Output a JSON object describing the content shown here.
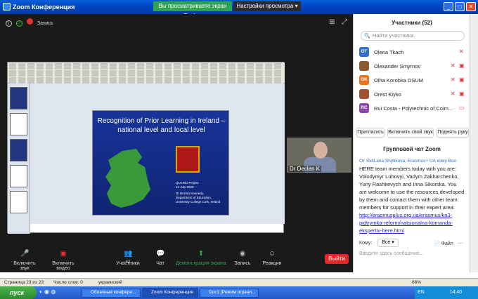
{
  "window": {
    "title": "Zoom Конференция"
  },
  "share_banner": {
    "text": "Вы просматриваете экран Declan",
    "view_options": "Настройки просмотра ▾"
  },
  "meeting": {
    "record_label": "Запись"
  },
  "slide": {
    "title": "Recognition of Prior Learning in Ireland – national level and local level",
    "project": "QUARiU Project\n14 July 2020",
    "author": "Dr Declan Kennedy,\nDepartment of Education,\nUniversity College Cork, Ireland"
  },
  "video": {
    "name": "Dr Declan K"
  },
  "toolbar": {
    "unmute": "Включить звук",
    "start_video": "Включить видео",
    "participants": "Участники",
    "participants_count": "62",
    "chat": "Чат",
    "share": "Демонстрация экрана",
    "record": "Запись",
    "reactions": "Реакции",
    "end": "Выйти"
  },
  "participants_panel": {
    "title": "Участники (52)",
    "search_placeholder": "Найти участника",
    "items": [
      {
        "initials": "OT",
        "name": "Olena Tkach",
        "color": "#2d6fcd"
      },
      {
        "initials": "",
        "name": "Olexander Smyrnov",
        "color": "#8b5a2b"
      },
      {
        "initials": "OK",
        "name": "Olha Korobka DSUM",
        "color": "#e8731a"
      },
      {
        "initials": "",
        "name": "Orest Kiyko",
        "color": "#a0522d"
      },
      {
        "initials": "RC",
        "name": "Rui Costa - Polytechnic of Coim...",
        "color": "#8e44ad"
      }
    ],
    "invite": "Пригласить",
    "unmute_me": "Включить свой звук",
    "raise_hand": "Поднять руку"
  },
  "chat_panel": {
    "title": "Групповой чат Zoom",
    "from": "От SvitLana Shytikova, Erasmus+ UA кому Все:",
    "message": "HERE team members today with you are: Volodymyr Luhovyi, Vadym Zakharchenko, Yuriy Rashkevych and Inna Sikorska. You are welcome to use the resources developed by them and contact them with other team members for support in their expert area:",
    "link": "http://erasmusplus.org.ua/erasmus/ka3-pidtrymka-reform/natsionalna-komanda-ekspertiv-here.html",
    "to_label": "Кому:",
    "to_value": "Все ▾",
    "file_label": "Файл",
    "input_placeholder": "Введите здесь сообщение..."
  },
  "statusbar": {
    "page": "Страница 23 из 23",
    "words": "Число слов: 0",
    "lang": "украинский",
    "zoom": "66%"
  },
  "taskbar": {
    "start": "пуск",
    "tasks": [
      "Облачные конфере...",
      "Zoom Конференция",
      "Doc1 [Режим ограни..."
    ],
    "lang": "EN",
    "time": "14:40"
  }
}
